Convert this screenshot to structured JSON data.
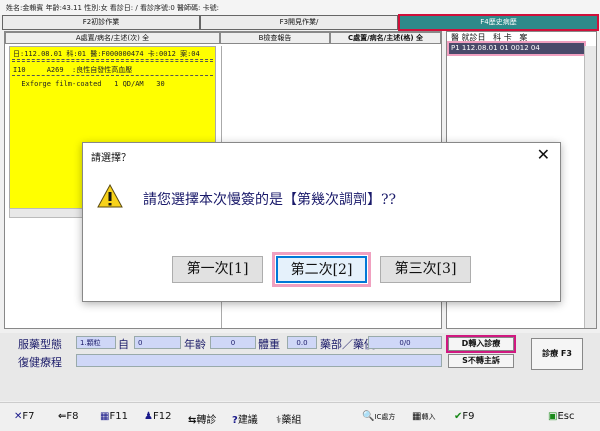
{
  "topbar": {
    "text": "姓名:金賴賓 年齡:43.11 性別:女 看診日:      / 看診序號:0 醫師碼: 卡號:"
  },
  "tabs": [
    {
      "label": "F2初診作業"
    },
    {
      "label": "F3開見作業/"
    },
    {
      "label": "F4歷史病歷"
    }
  ],
  "subtabs": [
    {
      "label": "A處置/病名/主述(次) 全"
    },
    {
      "label": "B檢查報告"
    },
    {
      "label": "C處置/病名/主述(格) 全"
    }
  ],
  "yellow": {
    "line1": "日:112.08.01 科:01 醫:F000000474 卡:0012 案:04",
    "line2": "I10     A269  :良性自發性高血壓",
    "line3": "  Exforge film-coated   1 QD/AM   30"
  },
  "right": {
    "header": "醫 就診日   科 卡   案",
    "row": "P1 112.08.01 01 0012 04"
  },
  "bottom": {
    "dosage_label": "服藥型態",
    "dosage_value": "1.顆粒",
    "self_label": "自",
    "self_value": "0",
    "age_label": "年齡",
    "age_value": "0",
    "weight_label": "體重",
    "weight_value": "0.0",
    "pharm_label": "藥部／藥優",
    "pharm_value": "0/0",
    "rehab_label": "復健療程",
    "import_btn": "D轉入診療",
    "noimport_btn": "S不轉主訴",
    "diag_btn": "診療 F3"
  },
  "footer": {
    "f7": "F7",
    "f8": "F8",
    "f11": "F11",
    "f12": "F12",
    "transfer": "轉診",
    "advice": "建議",
    "drug": "藥組",
    "ic": "IC",
    "ic2": "處方",
    "import": "轉入",
    "f9": "F9",
    "esc": "Esc"
  },
  "dialog": {
    "title": "請選擇？",
    "message": "請您選擇本次慢簽的是【第幾次調劑】??",
    "btn1": "第一次[1]",
    "btn2": "第二次[2]",
    "btn3": "第三次[3]"
  }
}
